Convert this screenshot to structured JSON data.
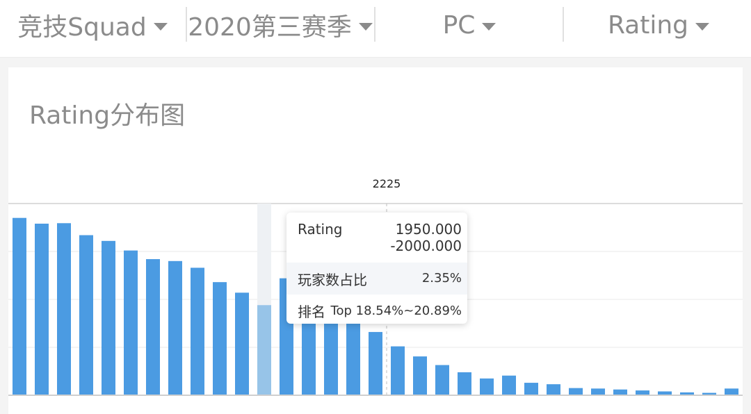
{
  "filters": [
    {
      "label": "竞技Squad"
    },
    {
      "label": "2020第三赛季"
    },
    {
      "label": "PC"
    },
    {
      "label": "Rating"
    }
  ],
  "card": {
    "title": "Rating分布图"
  },
  "marker_label": "2225",
  "tooltip": {
    "rating_label": "Rating",
    "rating_value_line1": "1950.000",
    "rating_value_line2": "-2000.000",
    "share_label": "玩家数占比",
    "share_value": "2.35%",
    "rank_label": "排名",
    "rank_value": "Top 18.54%~20.89%"
  },
  "colors": {
    "bar": "#4b9be2",
    "bar_highlight": "#97c4e8",
    "hover_band": "#eef1f4",
    "grid": "#e8e8e8",
    "marker_line": "#bdbdbd"
  },
  "chart_data": {
    "type": "bar",
    "title": "Rating分布图",
    "highlight_index": 11,
    "values": [
      3.7,
      3.58,
      3.59,
      3.34,
      3.22,
      3.02,
      2.84,
      2.8,
      2.66,
      2.36,
      2.14,
      1.88,
      2.44,
      2.36,
      2.1,
      1.86,
      1.32,
      1.02,
      0.81,
      0.63,
      0.48,
      0.35,
      0.41,
      0.26,
      0.23,
      0.15,
      0.14,
      0.12,
      0.1,
      0.08,
      0.06,
      0.05,
      0.14
    ],
    "ylim": [
      0,
      4.0
    ],
    "marker": {
      "label": "2225",
      "after_index": 16
    },
    "grid": true
  }
}
